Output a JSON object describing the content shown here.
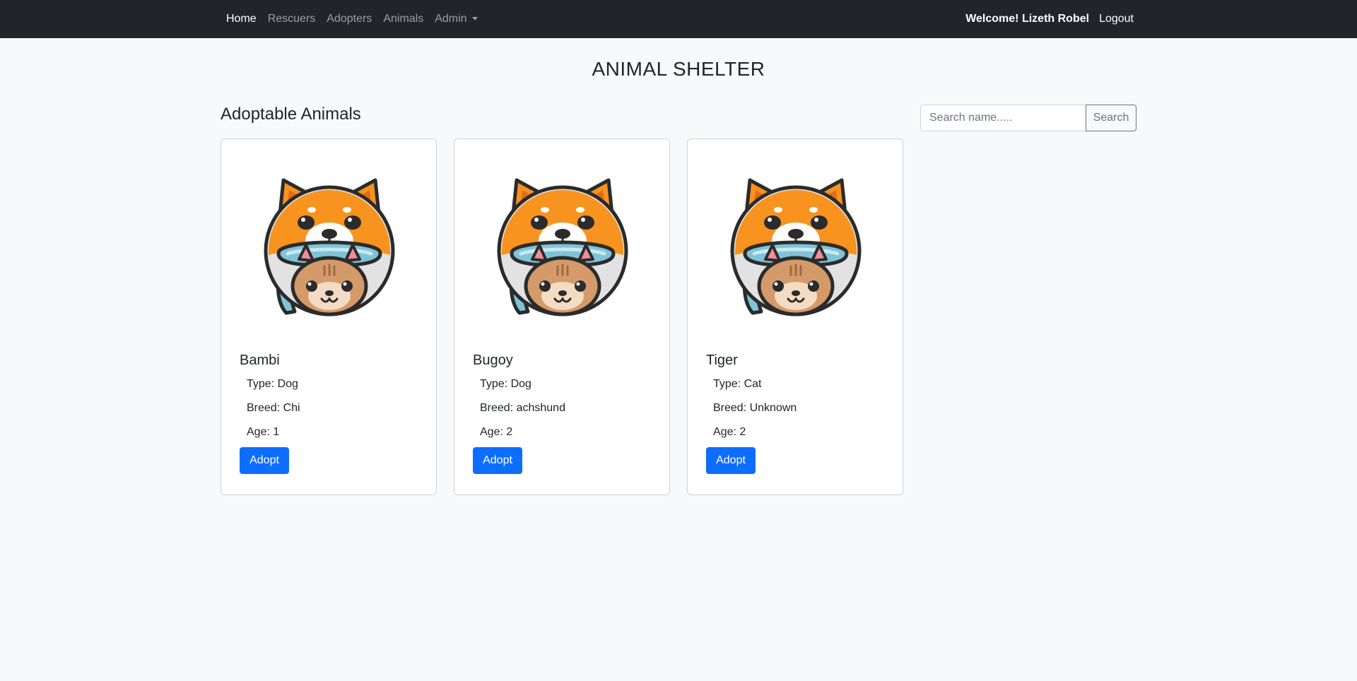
{
  "nav": {
    "links": [
      {
        "label": "Home",
        "active": true
      },
      {
        "label": "Rescuers",
        "active": false
      },
      {
        "label": "Adopters",
        "active": false
      },
      {
        "label": "Animals",
        "active": false
      }
    ],
    "admin_label": "Admin",
    "welcome": "Welcome! Lizeth Robel",
    "logout": "Logout"
  },
  "page": {
    "title": "ANIMAL SHELTER",
    "section_title": "Adoptable Animals"
  },
  "search": {
    "placeholder": "Search name.....",
    "value": "",
    "button": "Search"
  },
  "animals": [
    {
      "name": "Bambi",
      "type": "Type: Dog",
      "breed": "Breed: Chi",
      "age": "Age: 1",
      "adopt": "Adopt"
    },
    {
      "name": "Bugoy",
      "type": "Type: Dog",
      "breed": "Breed: achshund",
      "age": "Age: 2",
      "adopt": "Adopt"
    },
    {
      "name": "Tiger",
      "type": "Type: Cat",
      "breed": "Breed: Unknown",
      "age": "Age: 2",
      "adopt": "Adopt"
    }
  ],
  "colors": {
    "navbar": "#212529",
    "primary": "#0d6efd",
    "background": "#f8f9fa",
    "logo_orange": "#f7931e",
    "logo_blue": "#7fc4d6"
  },
  "icons": {
    "animal_image": "shiba-cat-helmet-logo"
  }
}
